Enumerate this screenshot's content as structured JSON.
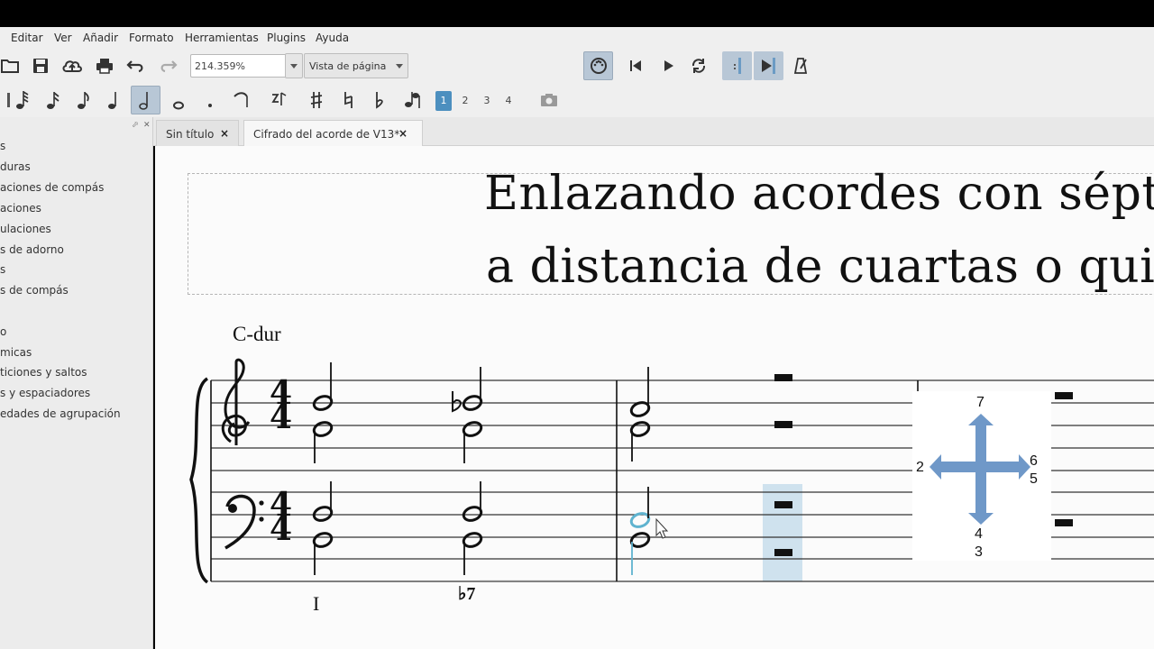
{
  "menu": [
    "Editar",
    "Ver",
    "Añadir",
    "Formato",
    "Herramientas",
    "Plugins",
    "Ayuda"
  ],
  "toolbar": {
    "zoom_value": "214.359%",
    "view_mode": "Vista de página",
    "icons": [
      "open-icon",
      "save-icon",
      "cloud-upload-icon",
      "print-icon",
      "undo-icon",
      "redo-icon"
    ],
    "playback_icons": [
      "midi-input-icon",
      "rewind-icon",
      "play-icon",
      "loop-icon",
      "loop-in-icon",
      "loop-out-icon",
      "metronome-icon"
    ]
  },
  "note_input": {
    "durations": [
      "64th",
      "32nd",
      "16th",
      "eighth",
      "quarter",
      "half",
      "whole",
      "dot"
    ],
    "active_duration": "half",
    "voices": [
      "1",
      "2",
      "3",
      "4"
    ],
    "active_voice": "1"
  },
  "palette": {
    "items": [
      "s",
      "duras",
      "aciones de compás",
      "aciones",
      "ulaciones",
      "s de adorno",
      "s",
      "s de compás",
      "",
      "o",
      "micas",
      "ticiones y saltos",
      "s y espaciadores",
      "edades de agrupación"
    ]
  },
  "tabs": [
    {
      "label": "Sin título",
      "close": "×"
    },
    {
      "label": "Cifrado del acorde de V13*",
      "close": "×"
    }
  ],
  "score": {
    "title_line1": "Enlazando acordes con séptim",
    "title_line2": "a distancia de cuartas o quint",
    "key": "C-dur",
    "time_signature": "4/4",
    "roman_numerals": [
      "I",
      "♭7"
    ]
  },
  "arrow_overlay": {
    "up": "7",
    "left": "2",
    "right_top": "6",
    "right_bottom": "5",
    "down_top": "4",
    "down_bottom": "3",
    "color": "#6f98c8"
  },
  "colors": {
    "accent": "#4c8fbf",
    "selection": "#cfe2ee",
    "selected_note": "#5fb3cf"
  }
}
